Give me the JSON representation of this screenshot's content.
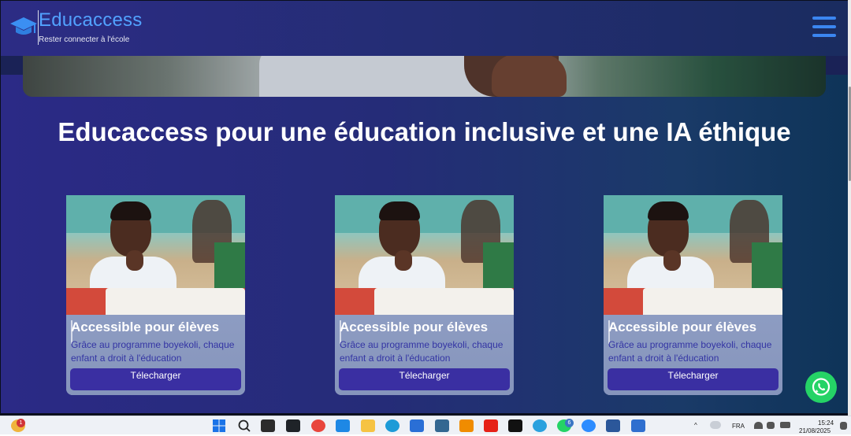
{
  "header": {
    "brand_name": "Educaccess",
    "tagline": "Rester connecter à l'école"
  },
  "hero": {
    "title": "Educaccess pour une éducation inclusive et une IA éthique"
  },
  "cards": [
    {
      "title": "Accessible pour élèves",
      "text": "Grâce au programme boyekoli, chaque enfant a droit à l'éducation",
      "button": "Télecharger"
    },
    {
      "title": "Accessible pour élèves",
      "text": "Grâce au programme boyekoli, chaque enfant a droit à l'éducation",
      "button": "Télecharger"
    },
    {
      "title": "Accessible pour élèves",
      "text": "Grâce au programme boyekoli, chaque enfant a droit à l'éducation",
      "button": "Télecharger"
    }
  ],
  "floating": {
    "whatsapp_icon": "whatsapp-icon"
  },
  "taskbar": {
    "weather_badge": "1",
    "whatsapp_badge": "6",
    "language": "FRA",
    "time": "15:24",
    "date": "21/08/2025"
  },
  "colors": {
    "brand_blue": "#52a2ff",
    "menu_blue": "#3b86f0",
    "button_purple": "#3a2fa2",
    "whatsapp_green": "#25d366"
  }
}
